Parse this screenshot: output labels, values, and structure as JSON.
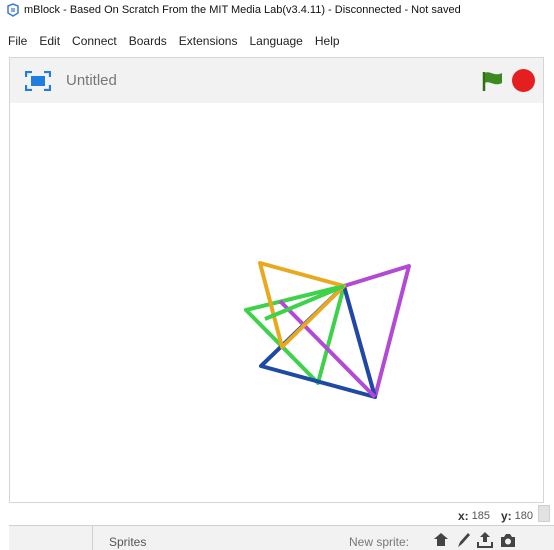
{
  "window": {
    "title": "mBlock - Based On Scratch From the MIT Media Lab(v3.4.11) - Disconnected - Not saved"
  },
  "menu": [
    "File",
    "Edit",
    "Connect",
    "Boards",
    "Extensions",
    "Language",
    "Help"
  ],
  "stage": {
    "project_title": "Untitled"
  },
  "coords": {
    "x_label": "x:",
    "x_value": "185",
    "y_label": "y:",
    "y_value": "180"
  },
  "sprites_panel": {
    "sprites_label": "Sprites",
    "new_sprite_label": "New sprite:"
  },
  "colors": {
    "stop": "#e51f1f",
    "flag": "#3c8a1e",
    "drawing": [
      "#e9a91e",
      "#3dd24a",
      "#b24ad6",
      "#1e4aa6"
    ]
  }
}
